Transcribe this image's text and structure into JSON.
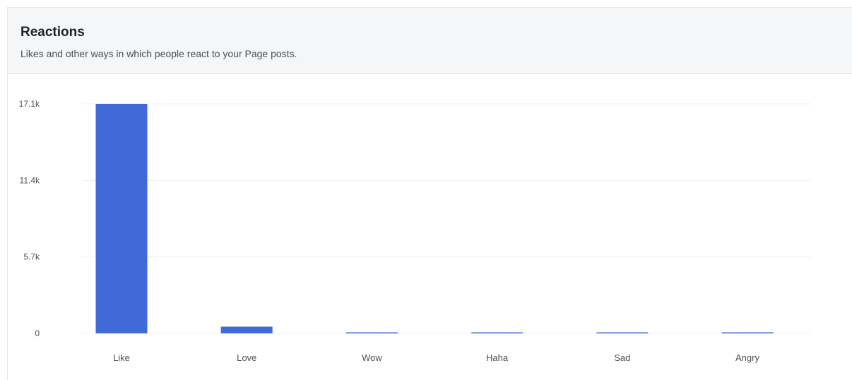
{
  "card": {
    "title": "Reactions",
    "subtitle": "Likes and other ways in which people react to your Page posts."
  },
  "chart_data": {
    "type": "bar",
    "title": "",
    "xlabel": "",
    "ylabel": "",
    "categories": [
      "Like",
      "Love",
      "Wow",
      "Haha",
      "Sad",
      "Angry"
    ],
    "values": [
      17100,
      500,
      40,
      30,
      20,
      20
    ],
    "y_ticks": [
      0,
      5700,
      11400,
      17100
    ],
    "y_tick_labels": [
      "0",
      "5.7k",
      "11.4k",
      "17.1k"
    ],
    "ylim": [
      0,
      17100
    ],
    "grid": true,
    "legend": "none",
    "bar_color": "#4169d8"
  }
}
